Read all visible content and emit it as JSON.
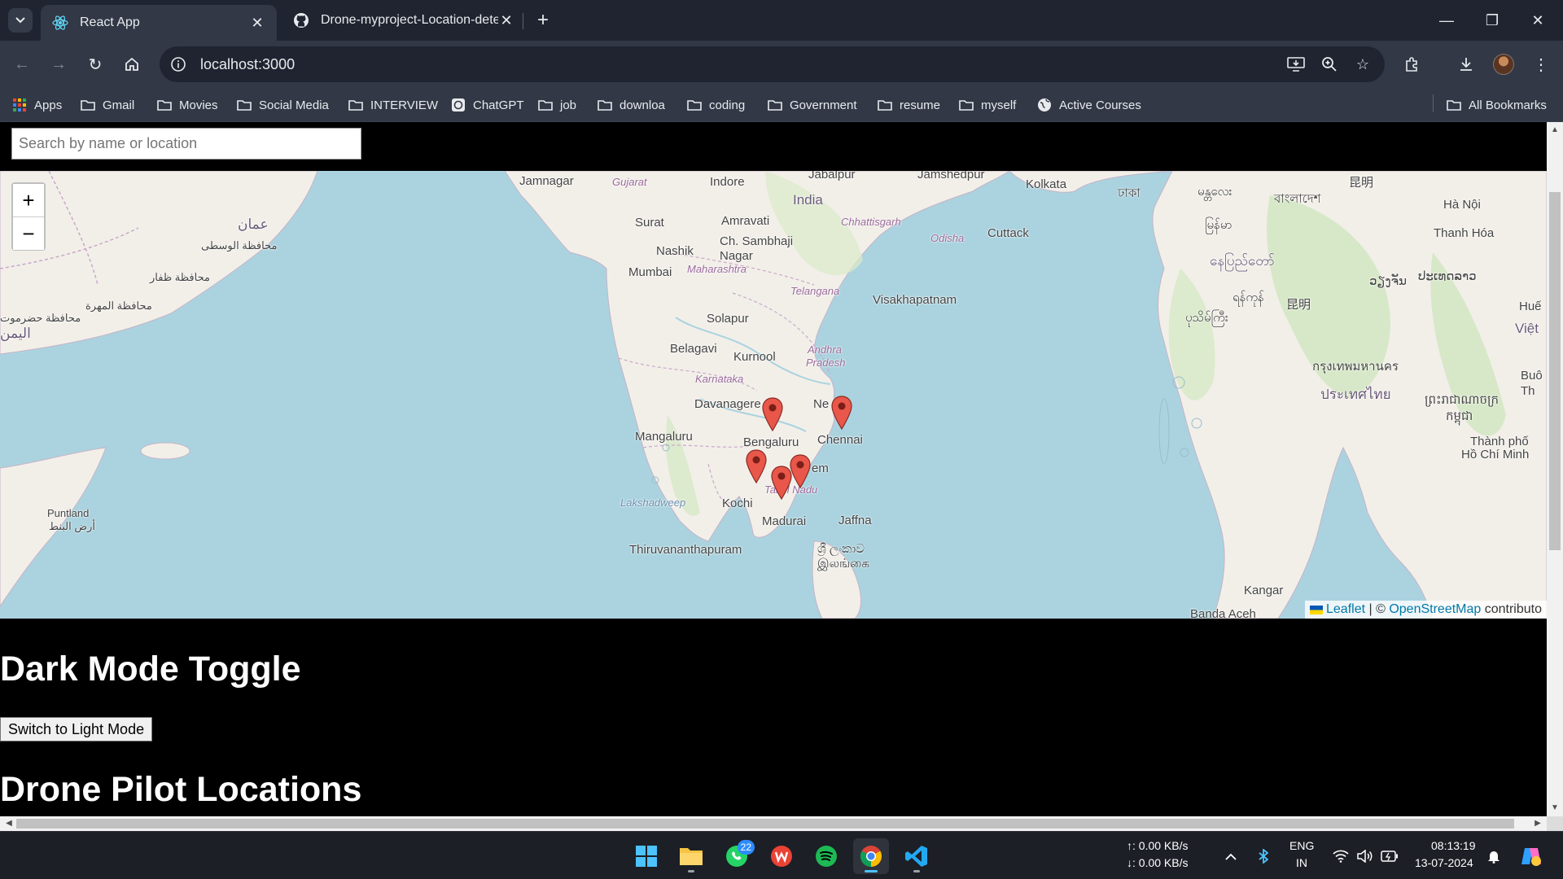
{
  "browser": {
    "tabs": [
      {
        "title": "React App",
        "icon": "react-icon",
        "active": true
      },
      {
        "title": "Drone-myproject-Location-dete",
        "icon": "github-icon",
        "active": false
      }
    ],
    "url": "localhost:3000",
    "bookmarks": [
      {
        "label": "Apps",
        "icon": "apps-grid-icon"
      },
      {
        "label": "Gmail",
        "icon": "folder-icon"
      },
      {
        "label": "Movies",
        "icon": "folder-icon"
      },
      {
        "label": "Social Media",
        "icon": "folder-icon"
      },
      {
        "label": "INTERVIEW",
        "icon": "folder-icon"
      },
      {
        "label": "ChatGPT",
        "icon": "chatgpt-icon"
      },
      {
        "label": "job",
        "icon": "folder-icon"
      },
      {
        "label": "downloa",
        "icon": "folder-icon"
      },
      {
        "label": "coding",
        "icon": "folder-icon"
      },
      {
        "label": "Government",
        "icon": "folder-icon"
      },
      {
        "label": "resume",
        "icon": "folder-icon"
      },
      {
        "label": "myself",
        "icon": "folder-icon"
      },
      {
        "label": "Active Courses",
        "icon": "globe-icon"
      }
    ],
    "all_bookmarks": "All Bookmarks"
  },
  "page": {
    "search": {
      "placeholder": "Search by name or location",
      "value": ""
    },
    "map": {
      "zoom_in": "+",
      "zoom_out": "−",
      "attribution": {
        "leaflet": "Leaflet",
        "separator": " | © ",
        "osm": "OpenStreetMap",
        "suffix": " contributo"
      },
      "labels": {
        "jamnagar": "Jamnagar",
        "gujarat": "Gujarat",
        "indore": "Indore",
        "jabalpur": "Jabalpur",
        "jamshedpur": "Jamshedpur",
        "kolkata": "Kolkata",
        "india": "India",
        "surat": "Surat",
        "amravati": "Amravati",
        "chhattisgarh": "Chhattisgarh",
        "sambhaji_1": "Ch. Sambhaji",
        "sambhaji_2": "Nagar",
        "nashik": "Nashik",
        "odisha": "Odisha",
        "cuttack": "Cuttack",
        "mumbai": "Mumbai",
        "maharashtra": "Maharashtra",
        "telangana": "Telangana",
        "visakhapatnam": "Visakhapatnam",
        "solapur": "Solapur",
        "belagavi": "Belagavi",
        "kurnool": "Kurnool",
        "andhra_1": "Andhra",
        "andhra_2": "Pradesh",
        "karnataka": "Karnataka",
        "davanagere": "Davanagere",
        "nellore": "Ne",
        "mangaluru": "Mangaluru",
        "bengaluru": "Bengaluru",
        "chennai": "Chennai",
        "salem": "em",
        "tamil_nadu": "Tamil Nadu",
        "lakshadweep": "Lakshadweep",
        "kochi": "Kochi",
        "madurai": "Madurai",
        "jaffna": "Jaffna",
        "thiruvananthapuram": "Thiruvananthapuram",
        "lanka_1": "ශ්‍රී ලංකාව",
        "lanka_2": "இலங்கை",
        "oman": "عمان",
        "wusta": "محافظة الوسطى",
        "dhofar": "محافظة ظفار",
        "mahra": "محافظة المهرة",
        "hadramaut": "محافظة حضرموت",
        "yemen": "اليمن",
        "puntland_1": "Puntland",
        "puntland_2": "أرض البنط",
        "dhaka": "ঢাকা",
        "bangladesh": "বাংলাদেশ",
        "myanmar_1": "မြန်မာ",
        "myanmar_2": "မန္တလေး",
        "yangon": "ရန်ကုန်",
        "naypyitaw": "နေပြည်တော်",
        "bago": "ပုသိမ်ကြီး",
        "kunming": "昆明",
        "hanoi": "Hà Nội",
        "thanh_hoa": "Thanh Hóa",
        "laos": "ປະເທດລາວ",
        "vientiane": "ວຽງຈັນ",
        "hue": "Huế",
        "viet": "Việt",
        "bangkok": "กรุงเทพมหานคร",
        "thailand": "ประเทศไทย",
        "buon": "Buô",
        "th": "Th",
        "cambodia_1": "ព្រះរាជាណាចក្រ",
        "cambodia_2": "កម្ពុជា",
        "hcmc_1": "Thành phố",
        "hcmc_2": "Hồ Chí Minh",
        "kangar": "Kangar",
        "banda_aceh": "Banda Aceh",
        "vietnam_top": "Việt Nam"
      },
      "marker_count": 5
    },
    "dark_mode_heading": "Dark Mode Toggle",
    "toggle_button": "Switch to Light Mode",
    "locations_heading": "Drone Pilot Locations"
  },
  "taskbar": {
    "whatsapp_badge": "22",
    "net_up": "↑: 0.00 KB/s",
    "net_down": "↓: 0.00 KB/s",
    "lang_1": "ENG",
    "lang_2": "IN",
    "time": "08:13:19",
    "date": "13-07-2024"
  },
  "colors": {
    "map_water": "#aad3df",
    "map_land": "#f2efe9",
    "marker": "#e8574a",
    "link": "#0078a8"
  }
}
